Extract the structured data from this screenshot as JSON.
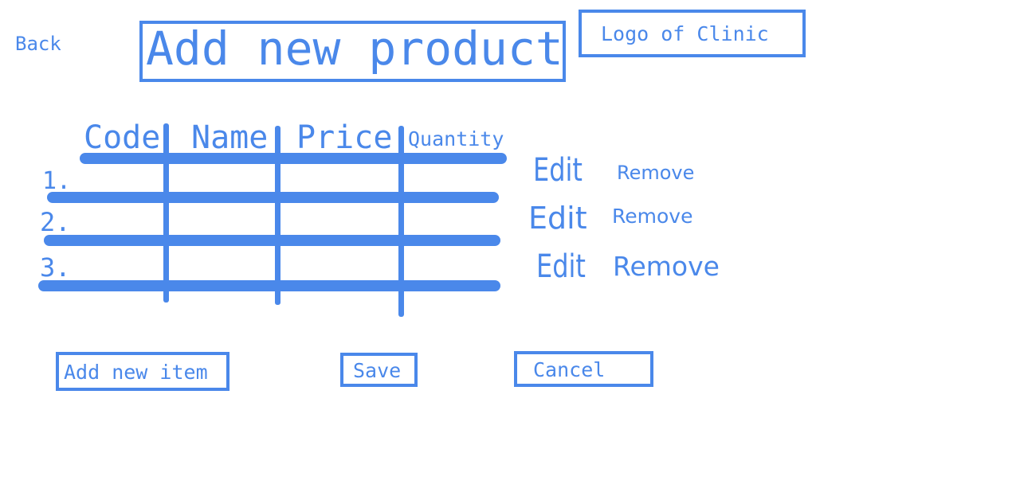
{
  "nav": {
    "back_label": "Back"
  },
  "header": {
    "title": "Add new product",
    "logo_label": "Logo of Clinic"
  },
  "table": {
    "columns": [
      "Code",
      "Name",
      "Price",
      "Quantity"
    ],
    "rows": [
      {
        "number": "1.",
        "edit_label": "Edit",
        "remove_label": "Remove"
      },
      {
        "number": "2.",
        "edit_label": "Edit",
        "remove_label": "Remove"
      },
      {
        "number": "3.",
        "edit_label": "Edit",
        "remove_label": "Remove"
      }
    ]
  },
  "actions": {
    "add_item_label": "Add new item",
    "save_label": "Save",
    "cancel_label": "Cancel"
  },
  "colors": {
    "accent": "#4a88ea",
    "background": "#ffffff"
  }
}
